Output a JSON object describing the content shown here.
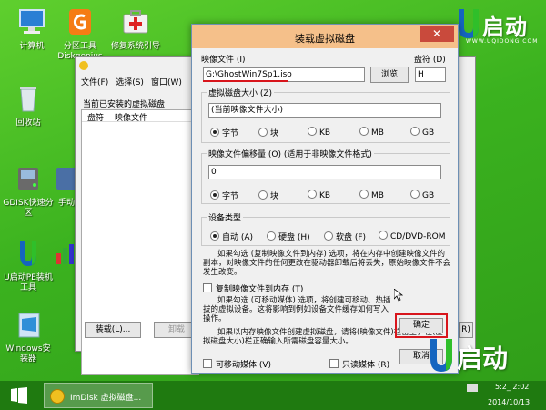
{
  "desktop": {
    "icons": [
      {
        "label": "计算机"
      },
      {
        "label": "分区工具\nDiskgenius"
      },
      {
        "label": "修复系统引导"
      },
      {
        "label": "回收站"
      },
      {
        "label": "GDISK快速分\n区"
      },
      {
        "label": "手动"
      },
      {
        "label": "U启动PE装机\n工具"
      },
      {
        "label": "Windows安\n装器"
      }
    ],
    "logo": {
      "text": "启动",
      "url": "WWW.UQIDONG.COM"
    },
    "bottom_logo": {
      "text": "启动"
    }
  },
  "bg_window": {
    "menu": [
      "文件(F)",
      "选择(S)",
      "窗口(W)"
    ],
    "heading": "当前已安装的虚拟磁盘",
    "columns": [
      "盘符",
      "映像文件"
    ],
    "load_button": "装载(L)...",
    "unload_button": "卸载"
  },
  "dialog": {
    "title": "装载虚拟磁盘",
    "close_glyph": "✕",
    "image_file": {
      "label": "映像文件 (I)",
      "value": "G:\\GhostWin7Sp1.iso",
      "browse": "浏览"
    },
    "drive": {
      "label": "盘符 (D)",
      "value": "H"
    },
    "size": {
      "label": "虚拟磁盘大小 (Z)",
      "value": "(当前映像文件大小)",
      "units": [
        "字节",
        "块",
        "KB",
        "MB",
        "GB"
      ],
      "selected": "字节"
    },
    "offset": {
      "label": "映像文件偏移量 (O) (适用于非映像文件格式)",
      "value": "0",
      "units": [
        "字节",
        "块",
        "KB",
        "MB",
        "GB"
      ],
      "selected": "字节"
    },
    "device_type": {
      "label": "设备类型",
      "options": [
        "自动 (A)",
        "硬盘 (H)",
        "软盘 (F)",
        "CD/DVD-ROM"
      ],
      "selected": "自动 (A)"
    },
    "desc1": "如果勾选 (复制映像文件到内存) 选项，将在内存中创建映像文件的副本，对映像文件的任何更改在驱动器卸载后将丢失，原始映像文件不会发生改变。",
    "copy_to_memory": "复制映像文件到内存 (T)",
    "desc2": "如果勾选 (可移动媒体) 选项，将创建可移动、热插拔的虚拟设备。这将影响到例如设备文件缓存如何写入操作。",
    "desc3": "如果以内存映像文件创建虚拟磁盘，请将(映像文件)栏留空，在(虚拟磁盘大小)栏正确输入所需磁盘容量大小。",
    "ok_button": "确定",
    "cancel_button": "取消",
    "removable": "可移动媒体 (V)",
    "readonly": "只读媒体 (R)"
  },
  "taskbar": {
    "start_icon": "windows-logo-icon",
    "task_label": "ImDisk 虚拟磁盘...",
    "clock_time": "5:2_ 2:02",
    "clock_date": "2014/10/13"
  },
  "colors": {
    "desktop_green": "#3bb21f",
    "title_orange": "#f5c08a",
    "close_red": "#c94a3c",
    "highlight_red": "#d8151c"
  }
}
